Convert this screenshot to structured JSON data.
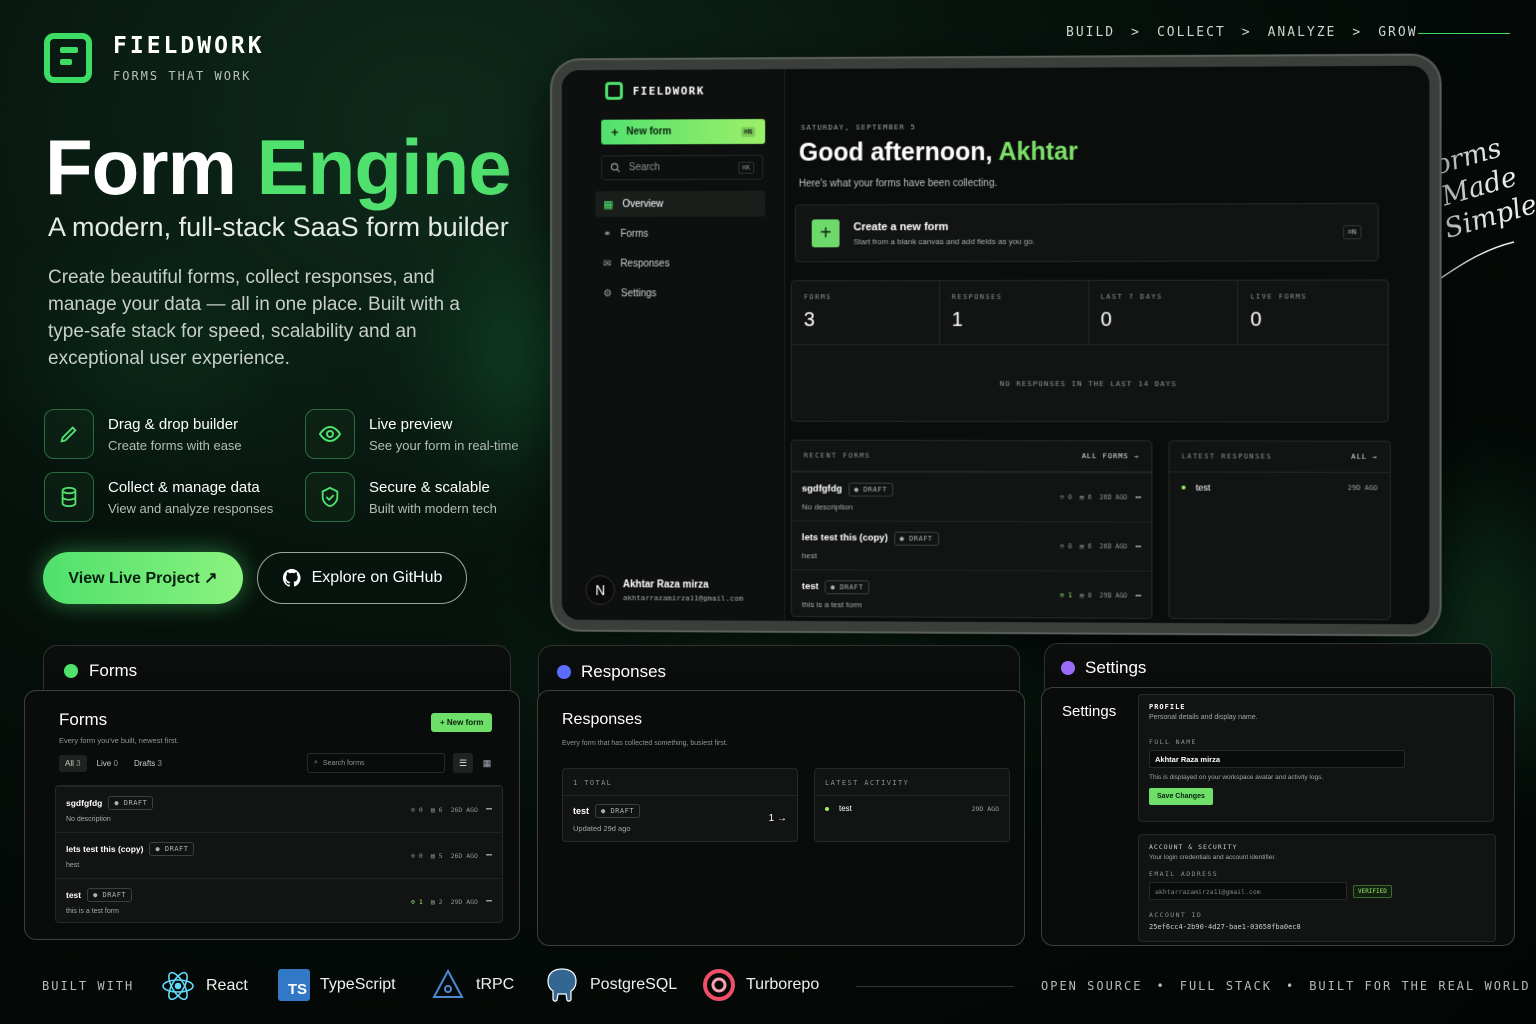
{
  "brand": {
    "name": "FIELDWORK",
    "tagline": "FORMS THAT WORK"
  },
  "topnav": {
    "steps": [
      "BUILD",
      "COLLECT",
      "ANALYZE",
      "GROW"
    ],
    "sep": ">"
  },
  "hero": {
    "title_a": "Form",
    "title_b": "Engine",
    "subtitle": "A modern, full-stack SaaS form builder",
    "description": "Create beautiful forms, collect responses, and manage your data — all in one place. Built with a type-safe stack for speed, scalability and an exceptional user experience."
  },
  "features": [
    {
      "icon": "pencil-icon",
      "title": "Drag & drop builder",
      "desc": "Create forms with ease"
    },
    {
      "icon": "eye-icon",
      "title": "Live preview",
      "desc": "See your form in real-time"
    },
    {
      "icon": "database-icon",
      "title": "Collect & manage data",
      "desc": "View and analyze responses"
    },
    {
      "icon": "shield-check-icon",
      "title": "Secure & scalable",
      "desc": "Built with modern tech"
    }
  ],
  "cta": {
    "primary": "View Live Project ↗",
    "secondary": "Explore on GitHub"
  },
  "handwritten": {
    "l1": "Forms",
    "l2": "Made",
    "l3": "Simple"
  },
  "app": {
    "brand": "FIELDWORK",
    "new_form": "New form",
    "new_form_kbd": "⌘N",
    "search": "Search",
    "search_kbd": "⌘K",
    "nav": [
      "Overview",
      "Forms",
      "Responses",
      "Settings"
    ],
    "user": {
      "initial": "N",
      "name": "Akhtar Raza mirza",
      "email": "akhtarrazamirza11@gmail.com"
    },
    "date": "SATURDAY, SEPTEMBER 5",
    "greeting": "Good afternoon,",
    "greeting_name": "Akhtar",
    "greeting_sub": "Here's what your forms have been collecting.",
    "create": {
      "title": "Create a new form",
      "desc": "Start from a blank canvas and add fields as you go.",
      "kbd": "⌘N"
    },
    "stats": [
      {
        "label": "FORMS",
        "value": "3"
      },
      {
        "label": "RESPONSES",
        "value": "1"
      },
      {
        "label": "LAST 7 DAYS",
        "value": "0"
      },
      {
        "label": "LIVE FORMS",
        "value": "0"
      }
    ],
    "empty": "NO RESPONSES IN THE LAST 14 DAYS",
    "recent": {
      "title": "RECENT FORMS",
      "link": "ALL FORMS →",
      "rows": [
        {
          "name": "sgdfgfdg",
          "badge": "● DRAFT",
          "desc": "No description",
          "r": "0",
          "f": "6",
          "age": "26D AGO"
        },
        {
          "name": "lets test this (copy)",
          "badge": "● DRAFT",
          "desc": "hest",
          "r": "0",
          "f": "6",
          "age": "26D AGO"
        },
        {
          "name": "test",
          "badge": "● DRAFT",
          "desc": "this is a test form",
          "r": "1",
          "f": "0",
          "age": "29D AGO"
        }
      ]
    },
    "latest": {
      "title": "LATEST RESPONSES",
      "link": "ALL →",
      "rows": [
        {
          "name": "test",
          "age": "29D AGO"
        }
      ]
    }
  },
  "panels": {
    "forms": {
      "tab": "Forms",
      "title": "Forms",
      "sub": "Every form you've built, newest first.",
      "new": "+ New form",
      "filters": [
        {
          "l": "All",
          "n": "3"
        },
        {
          "l": "Live",
          "n": "0"
        },
        {
          "l": "Drafts",
          "n": "3"
        }
      ],
      "search": "Search forms",
      "rows": [
        {
          "name": "sgdfgfdg",
          "badge": "● DRAFT",
          "desc": "No description",
          "r": "0",
          "f": "6",
          "age": "26D AGO"
        },
        {
          "name": "lets test this (copy)",
          "badge": "● DRAFT",
          "desc": "hest",
          "r": "0",
          "f": "5",
          "age": "26D AGO"
        },
        {
          "name": "test",
          "badge": "● DRAFT",
          "desc": "this is a test form",
          "r": "1",
          "f": "2",
          "age": "29D AGO"
        }
      ]
    },
    "responses": {
      "tab": "Responses",
      "title": "Responses",
      "sub": "Every form that has collected something, busiest first.",
      "total": "1 TOTAL",
      "row": {
        "name": "test",
        "badge": "● DRAFT",
        "updated": "Updated 29d ago",
        "count": "1 →"
      },
      "latest_title": "LATEST ACTIVITY",
      "latest": {
        "name": "test",
        "age": "29D AGO"
      }
    },
    "settings": {
      "tab": "Settings",
      "title": "Settings",
      "profile": "PROFILE",
      "profile_sub": "Personal details and display name.",
      "full_name_lbl": "FULL NAME",
      "full_name": "Akhtar Raza mirza",
      "hint": "This is displayed on your workspace avatar and activity logs.",
      "save": "Save Changes",
      "account": "ACCOUNT & SECURITY",
      "account_sub": "Your login credentials and account identifier.",
      "email_lbl": "EMAIL ADDRESS",
      "email": "akhtarrazamirza11@gmail.com",
      "verified": "VERIFIED",
      "id_lbl": "ACCOUNT ID",
      "id": "25ef6cc4-2b90-4d27-bae1-03658fba0ec8"
    }
  },
  "footer": {
    "built": "BUILT WITH",
    "tech": [
      "React",
      "TypeScript",
      "tRPC",
      "PostgreSQL",
      "Turborepo"
    ],
    "right": [
      "OPEN SOURCE",
      "FULL STACK",
      "BUILT FOR THE REAL WORLD"
    ]
  },
  "colors": {
    "accent": "#4fe06d",
    "lime": "#9cf06a",
    "purple": "#9a6bf5",
    "blue": "#5b6cff"
  }
}
